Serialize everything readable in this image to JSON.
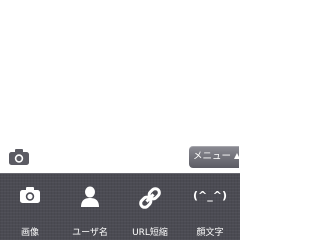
{
  "compose": {
    "text": ""
  },
  "menu_toggle": {
    "label": "メニュー"
  },
  "toolbar": {
    "items": [
      {
        "label": "画像",
        "icon": "camera-icon"
      },
      {
        "label": "ユーザ名",
        "icon": "user-icon"
      },
      {
        "label": "URL短縮",
        "icon": "link-icon"
      },
      {
        "label": "顔文字",
        "icon": "emoticon-icon",
        "glyph": "(^_^)"
      }
    ]
  },
  "colors": {
    "toolbar_bg": "#4b4b53",
    "icon_gray": "#5b5b63",
    "text_white": "#ffffff"
  }
}
